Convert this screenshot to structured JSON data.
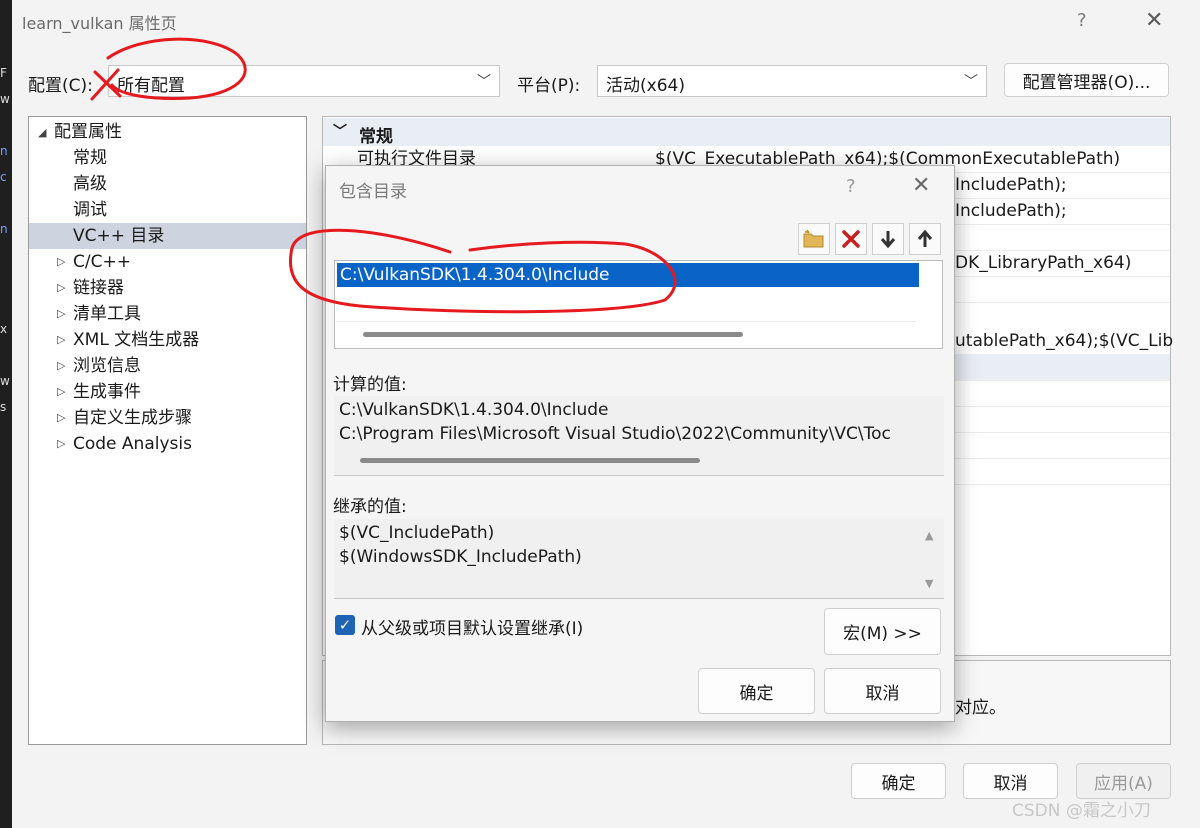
{
  "window": {
    "title": "learn_vulkan 属性页",
    "help": "?",
    "close": "✕"
  },
  "toolbar": {
    "config_label": "配置(C):",
    "config_value": "所有配置",
    "platform_label": "平台(P):",
    "platform_value": "活动(x64)",
    "config_manager": "配置管理器(O)..."
  },
  "tree": {
    "items": [
      {
        "label": "配置属性",
        "expanded": true,
        "level": 0
      },
      {
        "label": "常规",
        "level": 1
      },
      {
        "label": "高级",
        "level": 1
      },
      {
        "label": "调试",
        "level": 1
      },
      {
        "label": "VC++ 目录",
        "level": 1,
        "selected": true
      },
      {
        "label": "C/C++",
        "level": 1,
        "collapsed": true
      },
      {
        "label": "链接器",
        "level": 1,
        "collapsed": true
      },
      {
        "label": "清单工具",
        "level": 1,
        "collapsed": true
      },
      {
        "label": "XML 文档生成器",
        "level": 1,
        "collapsed": true
      },
      {
        "label": "浏览信息",
        "level": 1,
        "collapsed": true
      },
      {
        "label": "生成事件",
        "level": 1,
        "collapsed": true
      },
      {
        "label": "自定义生成步骤",
        "level": 1,
        "collapsed": true
      },
      {
        "label": "Code Analysis",
        "level": 1,
        "collapsed": true
      }
    ]
  },
  "grid": {
    "section": "常规",
    "rows": [
      {
        "name": "可执行文件目录",
        "value": "$(VC_ExecutablePath_x64);$(CommonExecutablePath)"
      },
      {
        "name": "",
        "value": "IncludePath);"
      },
      {
        "name": "",
        "value": "IncludePath);"
      },
      {
        "name": "",
        "value": ""
      },
      {
        "name": "",
        "value": "DK_LibraryPath_x64)"
      },
      {
        "name": "",
        "value": ""
      },
      {
        "name": "",
        "value": "utablePath_x64);$(VC_Lib"
      }
    ],
    "description_tail": "对应。"
  },
  "dialog": {
    "title": "包含目录",
    "help": "?",
    "close": "✕",
    "entries": [
      "C:\\VulkanSDK\\1.4.304.0\\Include"
    ],
    "computed_label": "计算的值:",
    "computed_values": [
      "C:\\VulkanSDK\\1.4.304.0\\Include",
      "C:\\Program Files\\Microsoft Visual Studio\\2022\\Community\\VC\\Toc"
    ],
    "inherited_label": "继承的值:",
    "inherited_values": [
      "$(VC_IncludePath)",
      "$(WindowsSDK_IncludePath)"
    ],
    "inherit_checkbox": "从父级或项目默认设置继承(I)",
    "inherit_checked": true,
    "macro_button": "宏(M) >>",
    "ok_button": "确定",
    "cancel_button": "取消"
  },
  "footer": {
    "ok": "确定",
    "cancel": "取消",
    "apply": "应用(A)"
  },
  "watermark": "CSDN @霜之小刀",
  "colors": {
    "selection": "#0a64c8",
    "annotation": "#e6191e",
    "tree_selection": "#cdd4e0"
  }
}
